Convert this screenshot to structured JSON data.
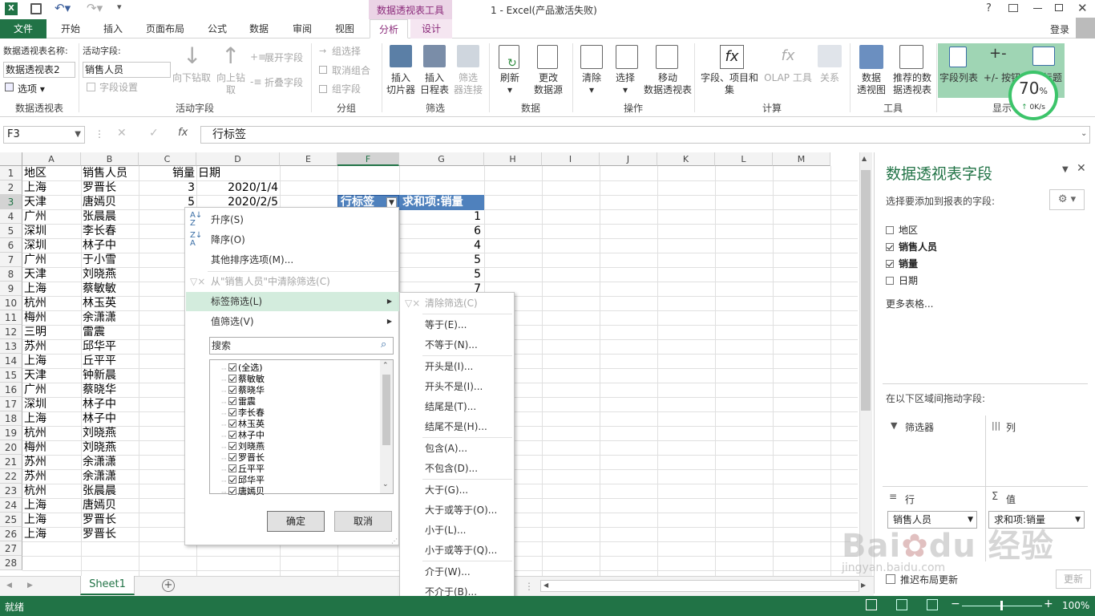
{
  "titlebar": {
    "tool_context": "数据透视表工具",
    "title": "1 - Excel(产品激活失败)",
    "help": "?",
    "login": "登录"
  },
  "tabs": [
    {
      "label": "文件"
    },
    {
      "label": "开始"
    },
    {
      "label": "插入"
    },
    {
      "label": "页面布局"
    },
    {
      "label": "公式"
    },
    {
      "label": "数据"
    },
    {
      "label": "审阅"
    },
    {
      "label": "视图"
    },
    {
      "label": "分析"
    },
    {
      "label": "设计"
    }
  ],
  "ribbon": {
    "pivot_name_label": "数据透视表名称:",
    "pivot_name_value": "数据透视表2",
    "options": "选项",
    "active_field_label": "活动字段:",
    "active_field_value": "销售人员",
    "field_settings": "字段设置",
    "drill_down": "向下钻取",
    "drill_up": "向上钻\n取",
    "expand": "展开字段",
    "collapse": "折叠字段",
    "group_sel": "组选择",
    "ungroup": "取消组合",
    "group_field": "组字段",
    "slicer": "插入\n切片器",
    "timeline": "插入\n日程表",
    "filter_conn": "筛选\n器连接",
    "refresh": "刷新",
    "change_source": "更改\n数据源",
    "clear": "清除",
    "select": "选择",
    "move": "移动\n数据透视表",
    "fields_items": "字段、项目和\n集",
    "olap": "OLAP 工具",
    "relations": "关系",
    "pivot_chart": "数据\n透视图",
    "recommended": "推荐的数\n据透视表",
    "field_list": "字段列表",
    "plusminus": "+/- 按钮",
    "headers": "标题",
    "groups": {
      "pivot": "数据透视表",
      "active": "活动字段",
      "group": "分组",
      "filter": "筛选",
      "data": "数据",
      "ops": "操作",
      "calc": "计算",
      "tools": "工具",
      "show": "显示"
    },
    "speed": {
      "percent": "70",
      "unit": "%",
      "rate": "0K/s"
    }
  },
  "formula_bar": {
    "namebox": "F3",
    "content": "行标签",
    "fx": "fx"
  },
  "columns": [
    "A",
    "B",
    "C",
    "D",
    "E",
    "F",
    "G",
    "H",
    "I",
    "J",
    "K",
    "L",
    "M"
  ],
  "rows": [
    {
      "n": "1",
      "a": "地区",
      "b": "销售人员",
      "c": "销量",
      "d": "日期"
    },
    {
      "n": "2",
      "a": "上海",
      "b": "罗晋长",
      "c": "3",
      "d": "2020/1/4"
    },
    {
      "n": "3",
      "a": "天津",
      "b": "唐嫣贝",
      "c": "5",
      "d": "2020/2/5"
    },
    {
      "n": "4",
      "a": "广州",
      "b": "张晨晨"
    },
    {
      "n": "5",
      "a": "深圳",
      "b": "李长春"
    },
    {
      "n": "6",
      "a": "深圳",
      "b": "林子中"
    },
    {
      "n": "7",
      "a": "广州",
      "b": "于小雪"
    },
    {
      "n": "8",
      "a": "天津",
      "b": "刘晓燕"
    },
    {
      "n": "9",
      "a": "上海",
      "b": "蔡敏敏"
    },
    {
      "n": "10",
      "a": "杭州",
      "b": "林玉英"
    },
    {
      "n": "11",
      "a": "梅州",
      "b": "余潇潇"
    },
    {
      "n": "12",
      "a": "三明",
      "b": "雷震"
    },
    {
      "n": "13",
      "a": "苏州",
      "b": "邱华平"
    },
    {
      "n": "14",
      "a": "上海",
      "b": "丘平平"
    },
    {
      "n": "15",
      "a": "天津",
      "b": "钟新晨"
    },
    {
      "n": "16",
      "a": "广州",
      "b": "蔡晓华"
    },
    {
      "n": "17",
      "a": "深圳",
      "b": "林子中"
    },
    {
      "n": "18",
      "a": "上海",
      "b": "林子中"
    },
    {
      "n": "19",
      "a": "杭州",
      "b": "刘晓燕"
    },
    {
      "n": "20",
      "a": "梅州",
      "b": "刘晓燕"
    },
    {
      "n": "21",
      "a": "苏州",
      "b": "余潇潇"
    },
    {
      "n": "22",
      "a": "苏州",
      "b": "余潇潇"
    },
    {
      "n": "23",
      "a": "杭州",
      "b": "张晨晨"
    },
    {
      "n": "24",
      "a": "上海",
      "b": "唐嫣贝"
    },
    {
      "n": "25",
      "a": "上海",
      "b": "罗晋长"
    },
    {
      "n": "26",
      "a": "上海",
      "b": "罗晋长"
    },
    {
      "n": "27"
    },
    {
      "n": "28"
    }
  ],
  "pivot": {
    "row_label": "行标签",
    "sum_label": "求和项:销量",
    "values": [
      "1",
      "6",
      "4",
      "5",
      "5",
      "7"
    ]
  },
  "context_menu": {
    "sort_asc": "升序(S)",
    "sort_desc": "降序(O)",
    "more_sort": "其他排序选项(M)...",
    "clear_filter": "从\"销售人员\"中清除筛选(C)",
    "label_filter": "标签筛选(L)",
    "value_filter": "值筛选(V)",
    "search_placeholder": "搜索",
    "items": [
      {
        "label": "(全选)",
        "checked": true
      },
      {
        "label": "蔡敏敏",
        "checked": true
      },
      {
        "label": "蔡晓华",
        "checked": true
      },
      {
        "label": "雷震",
        "checked": true
      },
      {
        "label": "李长春",
        "checked": true
      },
      {
        "label": "林玉英",
        "checked": true
      },
      {
        "label": "林子中",
        "checked": true
      },
      {
        "label": "刘晓燕",
        "checked": true
      },
      {
        "label": "罗晋长",
        "checked": true
      },
      {
        "label": "丘平平",
        "checked": true
      },
      {
        "label": "邱华平",
        "checked": true
      },
      {
        "label": "唐嫣贝",
        "checked": true
      }
    ],
    "ok": "确定",
    "cancel": "取消"
  },
  "submenu": {
    "clear": "清除筛选(C)",
    "eq": "等于(E)...",
    "neq": "不等于(N)...",
    "begins": "开头是(I)...",
    "not_begins": "开头不是(I)...",
    "ends": "结尾是(T)...",
    "not_ends": "结尾不是(H)...",
    "contains": "包含(A)...",
    "not_contains": "不包含(D)...",
    "gt": "大于(G)...",
    "gte": "大于或等于(O)...",
    "lt": "小于(L)...",
    "lte": "小于或等于(Q)...",
    "between": "介于(W)...",
    "not_between": "不介于(B)..."
  },
  "pane": {
    "title": "数据透视表字段",
    "subtitle": "选择要添加到报表的字段:",
    "fields": [
      {
        "label": "地区",
        "checked": false
      },
      {
        "label": "销售人员",
        "checked": true
      },
      {
        "label": "销量",
        "checked": true
      },
      {
        "label": "日期",
        "checked": false
      }
    ],
    "more": "更多表格...",
    "drag_hint": "在以下区域间拖动字段:",
    "filter_area": "筛选器",
    "col_area": "列",
    "row_area": "行",
    "val_area": "值",
    "row_field": "销售人员",
    "val_field": "求和项:销量",
    "defer": "推迟布局更新",
    "update": "更新"
  },
  "sheet_tab": "Sheet1",
  "status": {
    "ready": "就绪",
    "zoom": "100%"
  },
  "watermark": {
    "text": "Bai du 经验",
    "sub": "jingyan.baidu.com"
  }
}
